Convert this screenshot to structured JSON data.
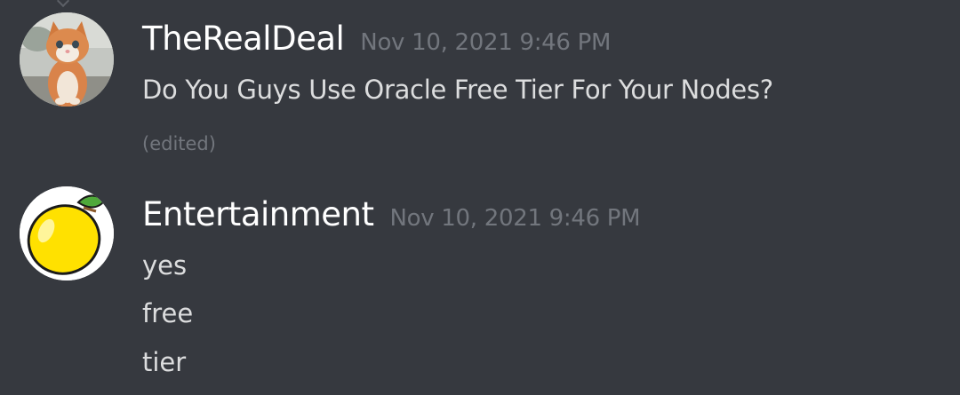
{
  "messages": [
    {
      "username": "TheRealDeal",
      "timestamp": "Nov 10, 2021 9:46 PM",
      "content": "Do You Guys Use Oracle Free Tier For Your Nodes?",
      "edited_label": "(edited)",
      "avatar_icon": "kitten-avatar"
    },
    {
      "username": "Entertainment",
      "timestamp": "Nov 10, 2021 9:46 PM",
      "lines": [
        "yes",
        "free",
        "tier"
      ],
      "avatar_icon": "lemon-avatar"
    }
  ],
  "colors": {
    "background": "#36393f",
    "username": "#ffffff",
    "timestamp": "#72767d",
    "message_text": "#dcddde"
  }
}
